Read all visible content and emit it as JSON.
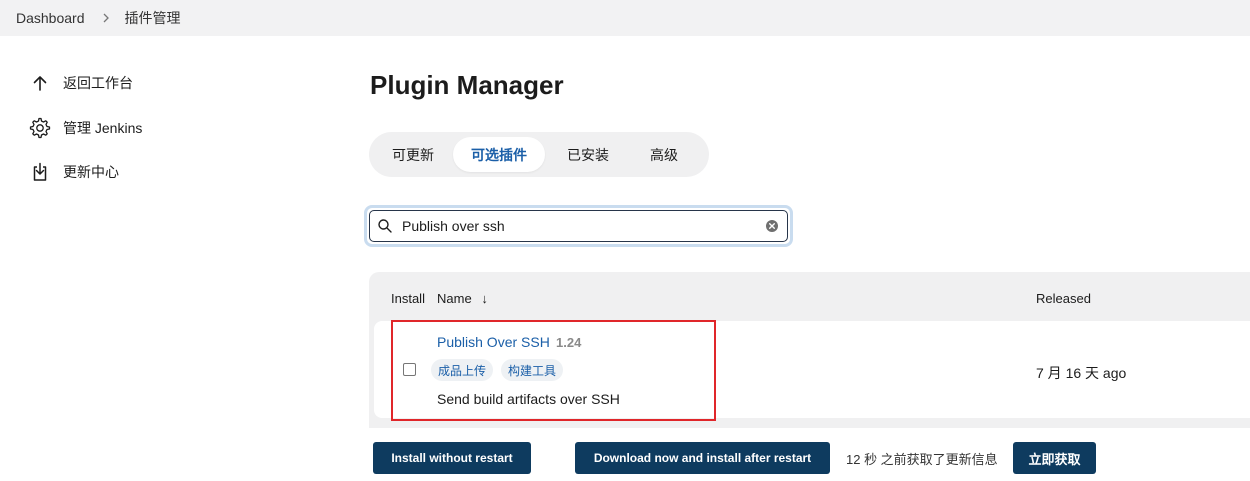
{
  "breadcrumb": {
    "items": [
      "Dashboard",
      "插件管理"
    ]
  },
  "sidebar": {
    "items": [
      {
        "label": "返回工作台",
        "icon": "arrow-up-icon"
      },
      {
        "label": "管理 Jenkins",
        "icon": "gear-icon"
      },
      {
        "label": "更新中心",
        "icon": "download-icon"
      }
    ]
  },
  "page": {
    "title": "Plugin Manager"
  },
  "tabs": [
    {
      "label": "可更新",
      "active": false
    },
    {
      "label": "可选插件",
      "active": true
    },
    {
      "label": "已安装",
      "active": false
    },
    {
      "label": "高级",
      "active": false
    }
  ],
  "search": {
    "value": "Publish over ssh",
    "icon": "search-icon",
    "clear_icon": "clear-icon"
  },
  "table": {
    "headers": {
      "install": "Install",
      "name": "Name",
      "sort_indicator": "↓",
      "released": "Released"
    },
    "rows": [
      {
        "name": "Publish Over SSH",
        "version": "1.24",
        "tags": [
          "成品上传",
          "构建工具"
        ],
        "description": "Send build artifacts over SSH",
        "released": "7 月 16 天 ago",
        "checked": false
      }
    ]
  },
  "actions": {
    "install_without_restart": "Install without restart",
    "download_install_after_restart": "Download now and install after restart",
    "status": "12 秒 之前获取了更新信息",
    "fetch_now": "立即获取"
  },
  "colors": {
    "accent": "#1b5fa8",
    "button_bg": "#0e3b5f",
    "highlight_border": "#e0262a"
  }
}
